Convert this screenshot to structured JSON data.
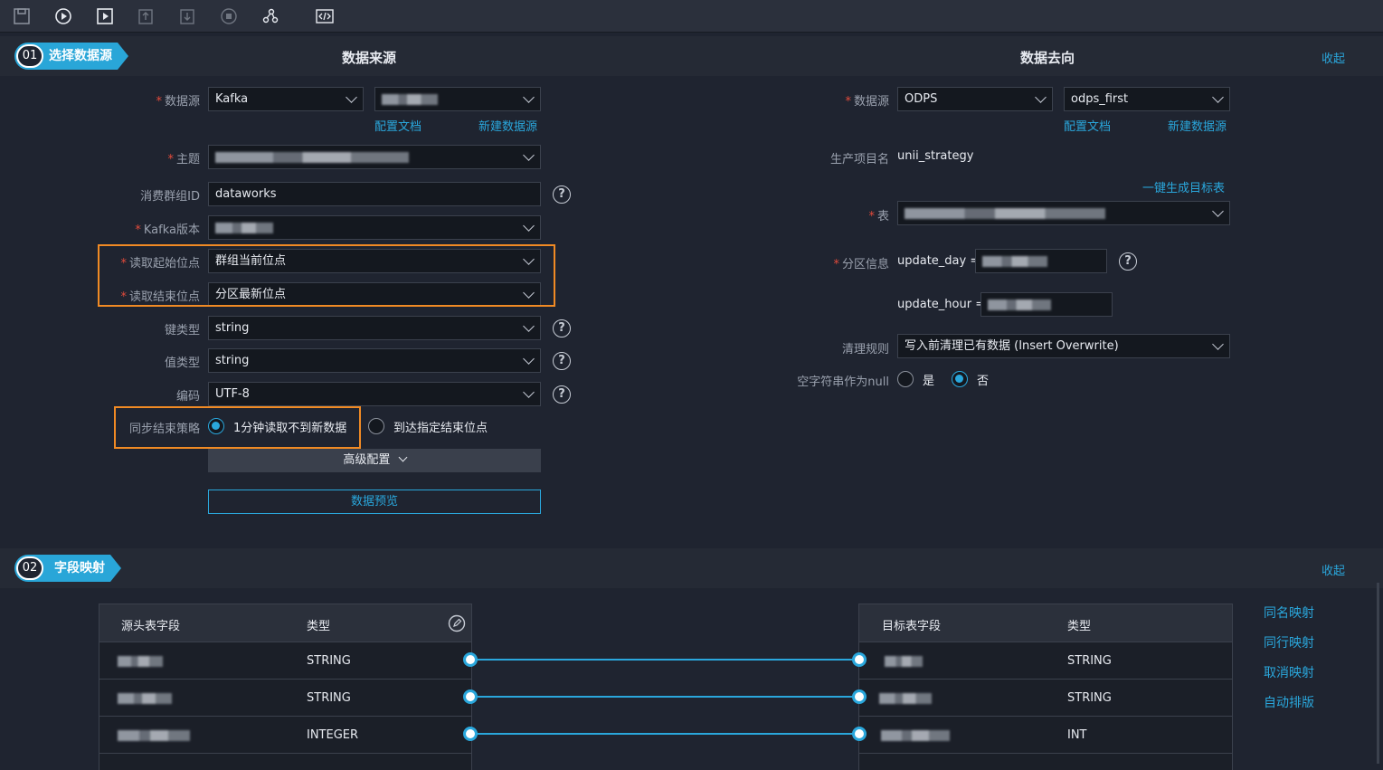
{
  "toolbar": {
    "icons": [
      "save-icon",
      "run-icon",
      "run-params-icon",
      "submit-icon",
      "unlock-icon",
      "stop-icon",
      "format-icon",
      "code-icon"
    ]
  },
  "section1": {
    "step": "01",
    "title": "选择数据源",
    "source_title": "数据来源",
    "target_title": "数据去向",
    "collapse": "收起"
  },
  "source": {
    "datasource_label": "数据源",
    "datasource_type": "Kafka",
    "config_doc": "配置文档",
    "new_datasource": "新建数据源",
    "topic_label": "主题",
    "consumer_group_label": "消费群组ID",
    "consumer_group_value": "dataworks",
    "version_label": "Kafka版本",
    "read_start_label": "读取起始位点",
    "read_start_value": "群组当前位点",
    "read_end_label": "读取结束位点",
    "read_end_value": "分区最新位点",
    "key_type_label": "键类型",
    "key_type_value": "string",
    "value_type_label": "值类型",
    "value_type_value": "string",
    "encoding_label": "编码",
    "encoding_value": "UTF-8",
    "sync_end_label": "同步结束策略",
    "sync_end_opt1": "1分钟读取不到新数据",
    "sync_end_opt2": "到达指定结束位点",
    "advanced": "高级配置",
    "preview": "数据预览"
  },
  "target": {
    "datasource_label": "数据源",
    "datasource_type": "ODPS",
    "datasource_name": "odps_first",
    "config_doc": "配置文档",
    "new_datasource": "新建数据源",
    "project_label": "生产项目名",
    "project_value": "unii_strategy",
    "gen_table": "一键生成目标表",
    "table_label": "表",
    "partition_label": "分区信息",
    "partition_day": "update_day =",
    "partition_hour": "update_hour =",
    "clean_label": "清理规则",
    "clean_value": "写入前清理已有数据 (Insert Overwrite)",
    "null_label": "空字符串作为null",
    "null_yes": "是",
    "null_no": "否"
  },
  "section2": {
    "step": "02",
    "title": "字段映射",
    "collapse": "收起"
  },
  "mapping": {
    "src_headers": [
      "源头表字段",
      "类型"
    ],
    "dst_headers": [
      "目标表字段",
      "类型"
    ],
    "src_types": [
      "STRING",
      "STRING",
      "INTEGER"
    ],
    "dst_types": [
      "STRING",
      "STRING",
      "INT"
    ],
    "actions": [
      "同名映射",
      "同行映射",
      "取消映射",
      "自动排版"
    ]
  }
}
